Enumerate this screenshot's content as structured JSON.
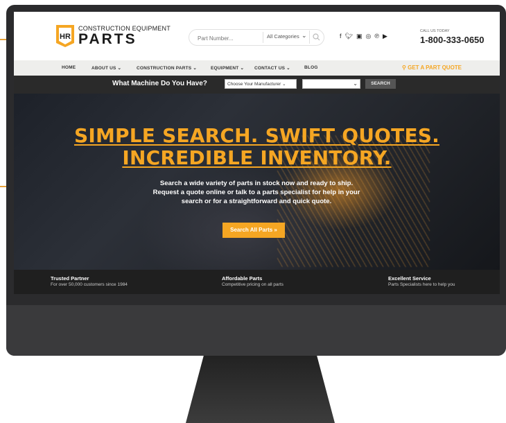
{
  "logo": {
    "top_text": "CONSTRUCTION EQUIPMENT",
    "bottom_text": "PARTS",
    "mark_text": "HR"
  },
  "search": {
    "placeholder": "Part Number...",
    "category": "All Categories"
  },
  "social_icons": [
    "facebook-icon",
    "twitter-icon",
    "linkedin-icon",
    "instagram-icon",
    "pinterest-icon",
    "youtube-icon"
  ],
  "call": {
    "label": "CALL US TODAY",
    "number": "1-800-333-0650"
  },
  "nav": {
    "items": [
      "HOME",
      "ABOUT US ⌄",
      "CONSTRUCTION PARTS ⌄",
      "EQUIPMENT ⌄",
      "CONTACT US ⌄",
      "BLOG"
    ],
    "quote": "GET A PART QUOTE"
  },
  "machine": {
    "label": "What Machine Do You Have?",
    "manufacturer": "Choose Your Manufacturer",
    "button": "SEARCH"
  },
  "hero": {
    "title_line1": "SIMPLE SEARCH. SWIFT QUOTES.",
    "title_line2": "INCREDIBLE INVENTORY.",
    "body_line1": "Search a wide variety of parts in stock now and ready to ship.",
    "body_line2": "Request a quote online or talk to a parts specialist for help in your",
    "body_line3": "search or for a straightforward and quick quote.",
    "button": "Search All Parts »"
  },
  "features": [
    {
      "title": "Trusted Partner",
      "subtitle": "For over 50,000 customers since 1984"
    },
    {
      "title": "Affordable Parts",
      "subtitle": "Competitive pricing on all parts"
    },
    {
      "title": "Excellent Service",
      "subtitle": "Parts Specialists here to help you"
    }
  ],
  "colors": {
    "accent": "#f5a623",
    "monitor": "#2b2b2d",
    "callout": "#e8a33a"
  }
}
